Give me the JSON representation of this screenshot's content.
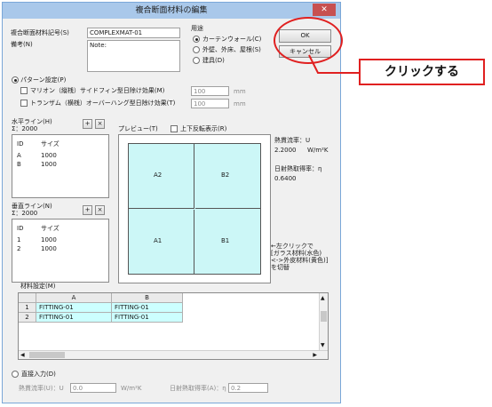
{
  "window": {
    "title": "複合断面材料の編集",
    "close": "✕"
  },
  "form": {
    "code_label": "複合断面材料記号(S)",
    "code_value": "COMPLEXMAT-01",
    "note_label": "備考(N)",
    "note_value": "Note:",
    "usage_label": "用途",
    "usage_options": [
      "カーテンウォール(C)",
      "外壁、外床、屋根(S)",
      "建具(D)"
    ],
    "ok": "OK",
    "cancel": "キャンセル"
  },
  "annotation": {
    "text": "クリックする",
    "color": "#e02020"
  },
  "pattern": {
    "label": "パターン設定(P)",
    "opt1": "マリオン（縦桟）サイドフィン型日除け効果(M)",
    "opt2": "トランザム（横桟）オーバーハング型日除け効果(T)",
    "opt1_value": "100",
    "opt2_value": "100",
    "unit": "mm"
  },
  "horizontal": {
    "label": "水平ライン(H)",
    "sum": "Σ：2000",
    "cols": [
      "ID",
      "サイズ"
    ],
    "rows": [
      [
        "A",
        "1000"
      ],
      [
        "B",
        "1000"
      ]
    ]
  },
  "vertical": {
    "label": "垂直ライン(N)",
    "sum": "Σ：2000",
    "cols": [
      "ID",
      "サイズ"
    ],
    "rows": [
      [
        "1",
        "1000"
      ],
      [
        "2",
        "1000"
      ]
    ]
  },
  "add": "+",
  "remove": "×",
  "preview": {
    "label": "プレビュー(T)",
    "flip": "上下反転表示(R)",
    "cells": [
      "A2",
      "B2",
      "A1",
      "B1"
    ],
    "fill": "#ccf7f7"
  },
  "stats": {
    "u_label": "熱貫流率：U",
    "u_value": "2.2000",
    "u_unit": "W/m²K",
    "eta_label": "日射熱取得率：η",
    "eta_value": "0.6400"
  },
  "hint": [
    "←左クリックで",
    "[ガラス材料(水色)",
    "<->外皮材料(黄色)]",
    "を切替"
  ],
  "material": {
    "label": "材料設定(M)",
    "cols": [
      "A",
      "B"
    ],
    "rows": [
      {
        "id": "1",
        "a": "FITTING-01",
        "b": "FITTING-01"
      },
      {
        "id": "2",
        "a": "FITTING-01",
        "b": "FITTING-01"
      }
    ]
  },
  "direct": {
    "label": "直接入力(D)",
    "u_label": "熱貫流率(U)：U",
    "u_value": "0.0",
    "u_unit": "W/m²K",
    "eta_label": "日射熱取得率(A)：η",
    "eta_value": "0.2"
  }
}
